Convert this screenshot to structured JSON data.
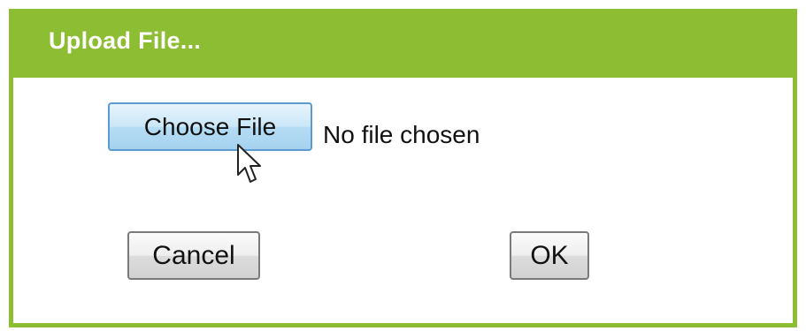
{
  "dialog": {
    "title": "Upload File...",
    "choose_file_label": "Choose File",
    "file_status": "No file chosen",
    "cancel_label": "Cancel",
    "ok_label": "OK"
  },
  "colors": {
    "titlebar": "#8dbd32",
    "choose_button": "#cbe7f8",
    "button_gray": "#e6e6e6"
  },
  "icons": {
    "cursor": "mouse-pointer-icon"
  }
}
